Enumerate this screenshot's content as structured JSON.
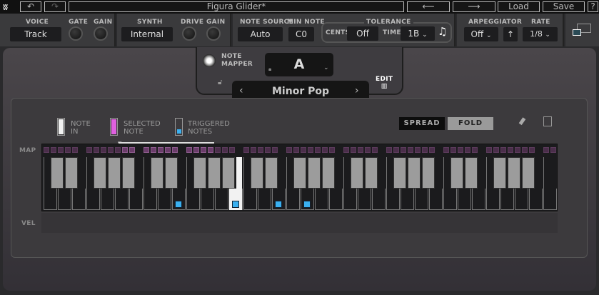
{
  "topbar": {
    "title": "Figura Glider*",
    "undo_icon": "undo-icon",
    "redo_icon": "redo-icon",
    "prev_icon": "arrow-left-icon",
    "next_icon": "arrow-right-icon",
    "load": "Load",
    "save": "Save",
    "help": "?"
  },
  "voice": {
    "label": "VOICE",
    "value": "Track",
    "gate": "GATE",
    "gain": "GAIN"
  },
  "synth": {
    "label": "SYNTH",
    "value": "Internal",
    "drive": "DRIVE",
    "gain": "GAIN"
  },
  "note_source": {
    "label": "NOTE SOURCE",
    "value": "Auto"
  },
  "min_note": {
    "label": "MIN NOTE",
    "value": "C0"
  },
  "tolerance": {
    "label": "TOLERANCE",
    "cents_label": "CENTS",
    "cents": "Off",
    "time_label": "TIME",
    "time": "1B"
  },
  "arpeggiator": {
    "label": "ARPEGGIATOR",
    "value": "Off",
    "direction": "↑",
    "rate_label": "RATE",
    "rate": "1/8"
  },
  "mapper": {
    "label_1": "NOTE",
    "label_2": "MAPPER",
    "key": "A",
    "scale": "Minor Pop",
    "edit": "EDIT"
  },
  "legend": {
    "note_in_1": "NOTE",
    "note_in_2": "IN",
    "selected_1": "SELECTED",
    "selected_2": "NOTE",
    "triggered_1": "TRIGGERED",
    "triggered_2": "NOTES"
  },
  "modes": {
    "spread": "SPREAD",
    "fold": "FOLD",
    "active": "FOLD"
  },
  "rows": {
    "map": "MAP",
    "vel": "VEL"
  },
  "colors": {
    "selected": "#e060e0",
    "triggered": "#3ab0f0",
    "note_in": "#f2f2f2",
    "map_square": "#4a2e4a",
    "map_selected": "#6a3c6a"
  }
}
